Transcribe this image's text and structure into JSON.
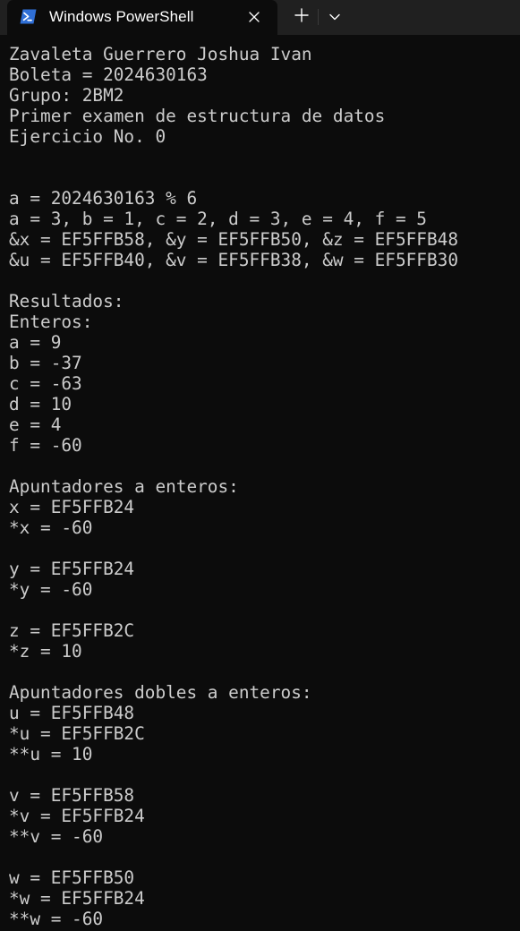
{
  "window": {
    "tab_title": "Windows PowerShell",
    "tab_icon": "powershell-icon",
    "close_icon": "close-icon",
    "new_tab_icon": "plus-icon",
    "dropdown_icon": "chevron-down-icon"
  },
  "colors": {
    "background": "#0c0c0c",
    "titlebar": "#202020",
    "text": "#cccccc",
    "powershell_blue": "#2f6fd6"
  },
  "terminal": {
    "lines": [
      "Zavaleta Guerrero Joshua Ivan",
      "Boleta = 2024630163",
      "Grupo: 2BM2",
      "Primer examen de estructura de datos",
      "Ejercicio No. 0",
      "",
      "",
      "a = 2024630163 % 6",
      "a = 3, b = 1, c = 2, d = 3, e = 4, f = 5",
      "&x = EF5FFB58, &y = EF5FFB50, &z = EF5FFB48",
      "&u = EF5FFB40, &v = EF5FFB38, &w = EF5FFB30",
      "",
      "Resultados:",
      "Enteros:",
      "a = 9",
      "b = -37",
      "c = -63",
      "d = 10",
      "e = 4",
      "f = -60",
      "",
      "Apuntadores a enteros:",
      "x = EF5FFB24",
      "*x = -60",
      "",
      "y = EF5FFB24",
      "*y = -60",
      "",
      "z = EF5FFB2C",
      "*z = 10",
      "",
      "Apuntadores dobles a enteros:",
      "u = EF5FFB48",
      "*u = EF5FFB2C",
      "**u = 10",
      "",
      "v = EF5FFB58",
      "*v = EF5FFB24",
      "**v = -60",
      "",
      "w = EF5FFB50",
      "*w = EF5FFB24",
      "**w = -60"
    ]
  }
}
